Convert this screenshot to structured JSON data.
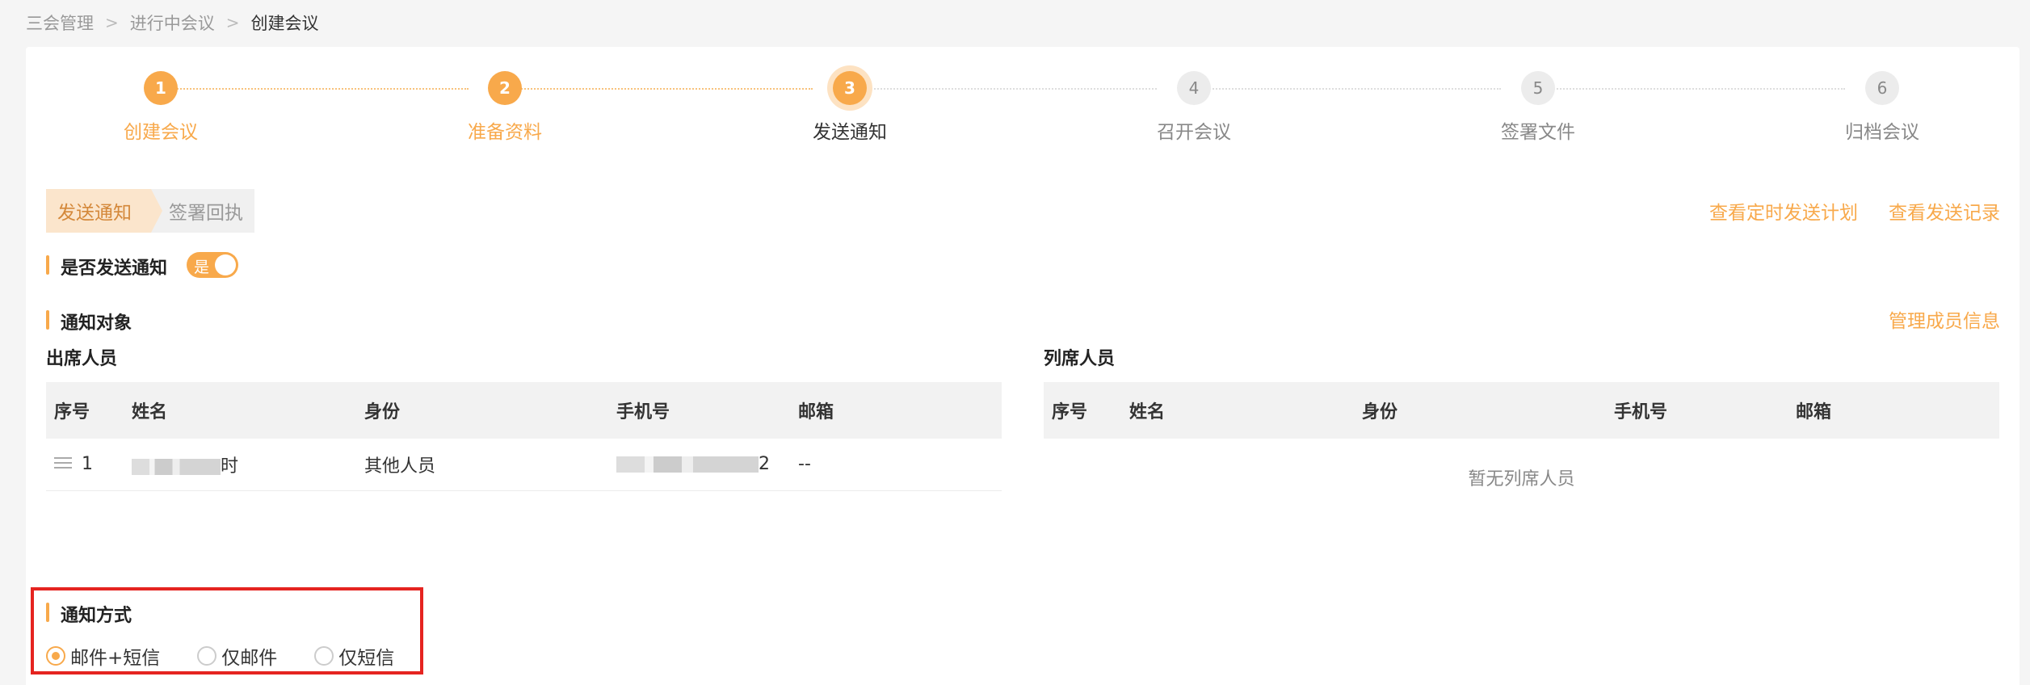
{
  "breadcrumb": {
    "items": [
      "三会管理",
      "进行中会议"
    ],
    "current": "创建会议",
    "separator": ">"
  },
  "steps": [
    {
      "number": "1",
      "label": "创建会议",
      "status": "done"
    },
    {
      "number": "2",
      "label": "准备资料",
      "status": "done"
    },
    {
      "number": "3",
      "label": "发送通知",
      "status": "active"
    },
    {
      "number": "4",
      "label": "召开会议",
      "status": "pending"
    },
    {
      "number": "5",
      "label": "签署文件",
      "status": "pending"
    },
    {
      "number": "6",
      "label": "归档会议",
      "status": "pending"
    }
  ],
  "tabs": [
    {
      "label": "发送通知",
      "active": true
    },
    {
      "label": "签署回执",
      "active": false
    }
  ],
  "top_links": {
    "schedule": "查看定时发送计划",
    "records": "查看发送记录"
  },
  "send_notice": {
    "title": "是否发送通知",
    "toggle_text": "是",
    "enabled": true
  },
  "notify_target": {
    "title": "通知对象",
    "manage_link": "管理成员信息"
  },
  "attendees": {
    "title": "出席人员",
    "columns": [
      "序号",
      "姓名",
      "身份",
      "手机号",
      "邮箱"
    ],
    "rows": [
      {
        "index": "1",
        "name": "时",
        "role": "其他人员",
        "phone": "2",
        "email": "--"
      }
    ]
  },
  "observers": {
    "title": "列席人员",
    "columns": [
      "序号",
      "姓名",
      "身份",
      "手机号",
      "邮箱"
    ],
    "empty_text": "暂无列席人员"
  },
  "notify_method": {
    "title": "通知方式",
    "options": [
      {
        "label": "邮件+短信",
        "checked": true
      },
      {
        "label": "仅邮件",
        "checked": false
      },
      {
        "label": "仅短信",
        "checked": false
      }
    ]
  },
  "colors": {
    "accent": "#f8a94b",
    "highlight_border": "#e52420"
  }
}
